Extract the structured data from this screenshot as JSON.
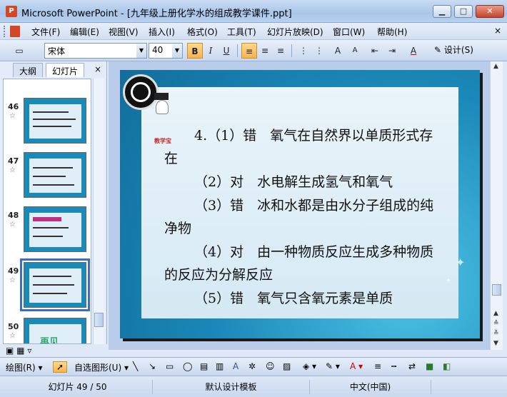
{
  "window": {
    "title": "Microsoft PowerPoint - [九年级上册化学水的组成教学课件.ppt]",
    "minimize": "▁",
    "maximize": "□",
    "close": "✕"
  },
  "menu": {
    "items": [
      "文件(F)",
      "编辑(E)",
      "视图(V)",
      "插入(I)",
      "格式(O)",
      "工具(T)",
      "幻灯片放映(D)",
      "窗口(W)",
      "帮助(H)"
    ],
    "close": "×"
  },
  "toolbar": {
    "font_name": "宋体",
    "font_size": "40",
    "bold": "B",
    "italic": "I",
    "underline": "U",
    "design_label": "设计(S)"
  },
  "left_pane": {
    "tabs": [
      "大纲",
      "幻灯片"
    ],
    "close": "×",
    "slides": [
      {
        "num": "46",
        "star": "☆"
      },
      {
        "num": "47",
        "star": "☆"
      },
      {
        "num": "48",
        "star": "☆"
      },
      {
        "num": "49",
        "star": "☆"
      },
      {
        "num": "50",
        "star": "☆",
        "text": "再见"
      }
    ]
  },
  "slide": {
    "logo_label": "教学宝",
    "lines": [
      "4.（1）错　氧气在自然界以单质形式存在",
      "（2）对　水电解生成氢气和氧气",
      "（3）错　冰和水都是由水分子组成的纯净物",
      "（4）对　由一种物质反应生成多种物质的反应为分解反应",
      "（5）错　氧气只含氧元素是单质"
    ]
  },
  "drawbar": {
    "draw": "绘图(R)",
    "autoshapes": "自选图形(U)"
  },
  "status": {
    "slide_pos": "幻灯片 49 / 50",
    "template": "默认设计模板",
    "language": "中文(中国)"
  },
  "colors": {
    "slide_blue": "#1a88b8",
    "accent_orange": "#f7b34c"
  }
}
